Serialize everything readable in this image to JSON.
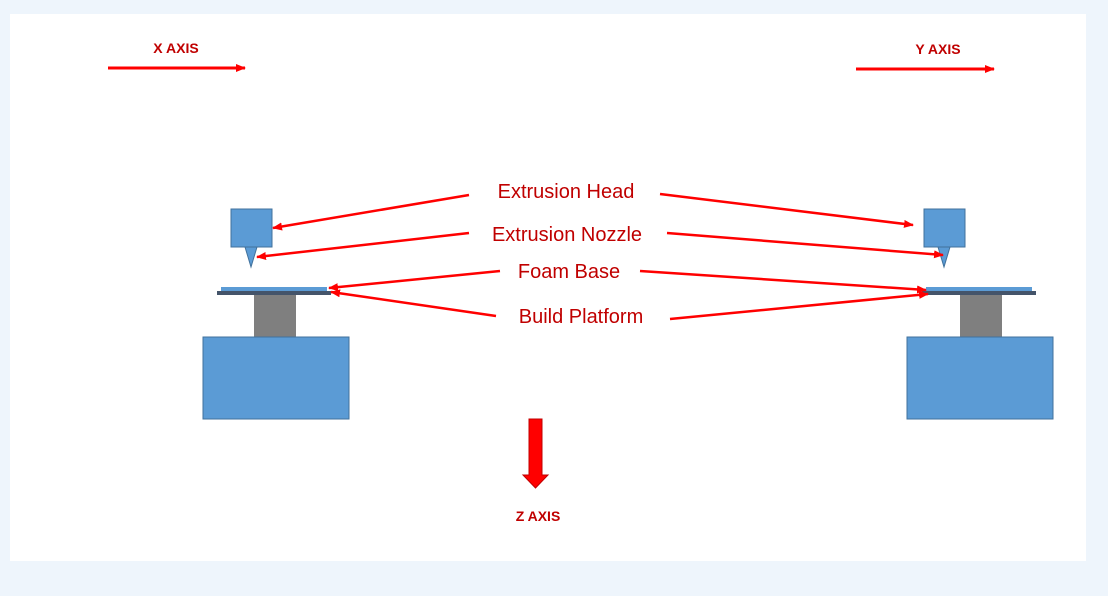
{
  "colors": {
    "background": "#eef5fc",
    "canvas": "#ffffff",
    "arrow_red": "#ff0000",
    "label_red": "#c00000",
    "device_blue": "#5b9bd5",
    "device_outline": "#41719c",
    "column_gray": "#7f7f7f",
    "platform_dark": "#44546a"
  },
  "axes": {
    "x_label": "X AXIS",
    "y_label": "Y AXIS",
    "z_label": "Z AXIS"
  },
  "callouts": {
    "extrusion_head": "Extrusion Head",
    "extrusion_nozzle": "Extrusion Nozzle",
    "foam_base": "Foam Base",
    "build_platform": "Build Platform"
  },
  "icons": {
    "axis_arrow": "right-arrow-icon",
    "z_arrow": "down-arrow-icon"
  }
}
